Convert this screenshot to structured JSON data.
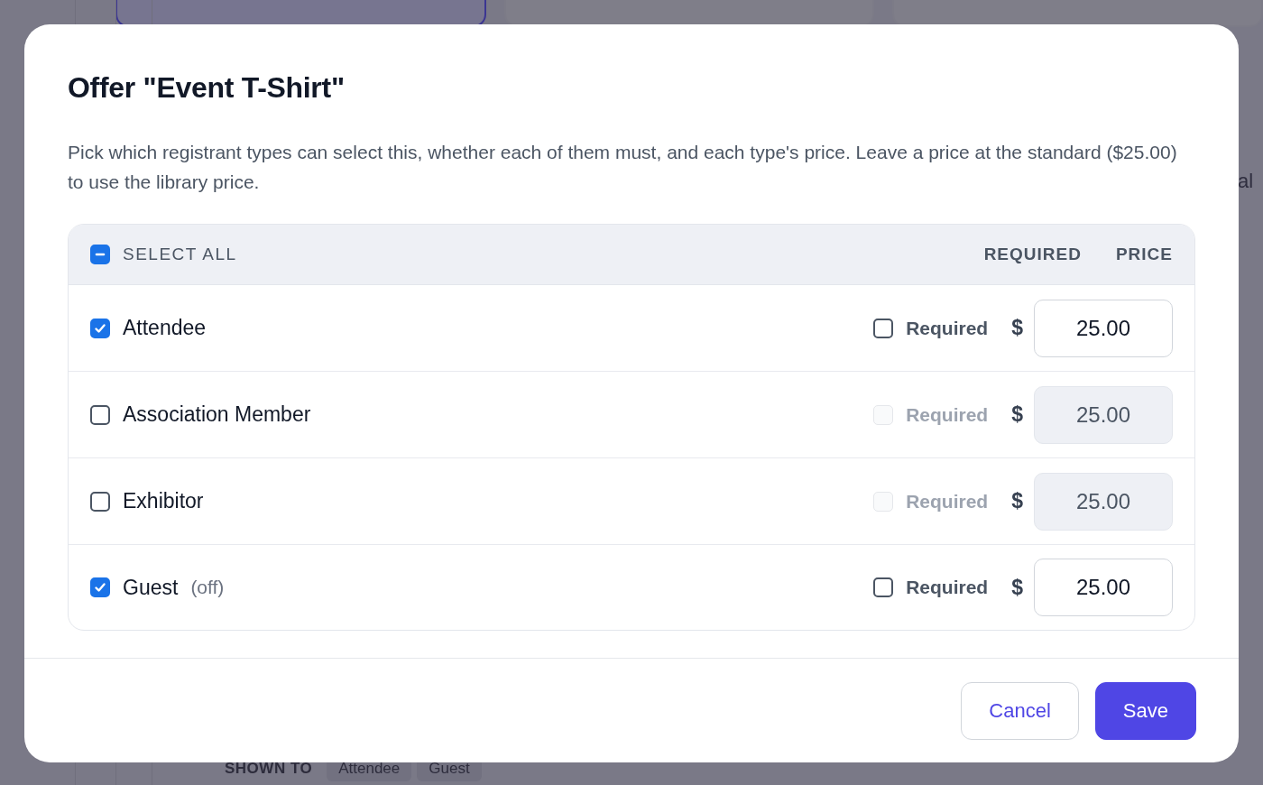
{
  "background": {
    "tabs": [
      {
        "selected": true
      },
      {
        "selected": false
      },
      {
        "selected": false
      }
    ],
    "side_text": "al",
    "shown_to": {
      "label": "SHOWN TO",
      "chips": [
        "Attendee",
        "Guest"
      ]
    }
  },
  "dialog": {
    "title": "Offer \"Event T-Shirt\"",
    "description": "Pick which registrant types can select this, whether each of them must, and each type's price. Leave a price at the standard ($25.00) to use the library price.",
    "table": {
      "select_all": {
        "label": "SELECT ALL",
        "indeterminate": true
      },
      "columns": [
        "REQUIRED",
        "PRICE"
      ],
      "rows": [
        {
          "name": "Attendee",
          "checked": true,
          "required": {
            "label": "Required",
            "checked": false,
            "disabled": false
          },
          "currency": "$",
          "price": {
            "value": "25.00",
            "disabled": false
          }
        },
        {
          "name": "Association Member",
          "checked": false,
          "required": {
            "label": "Required",
            "checked": false,
            "disabled": true
          },
          "currency": "$",
          "price": {
            "value": "25.00",
            "disabled": true
          }
        },
        {
          "name": "Exhibitor",
          "checked": false,
          "required": {
            "label": "Required",
            "checked": false,
            "disabled": true
          },
          "currency": "$",
          "price": {
            "value": "25.00",
            "disabled": true
          }
        },
        {
          "name": "Guest",
          "note": "(off)",
          "checked": true,
          "required": {
            "label": "Required",
            "checked": false,
            "disabled": false
          },
          "currency": "$",
          "price": {
            "value": "25.00",
            "disabled": false
          }
        }
      ]
    },
    "buttons": [
      {
        "label": "Cancel",
        "kind": "secondary"
      },
      {
        "label": "Save",
        "kind": "primary"
      }
    ]
  }
}
